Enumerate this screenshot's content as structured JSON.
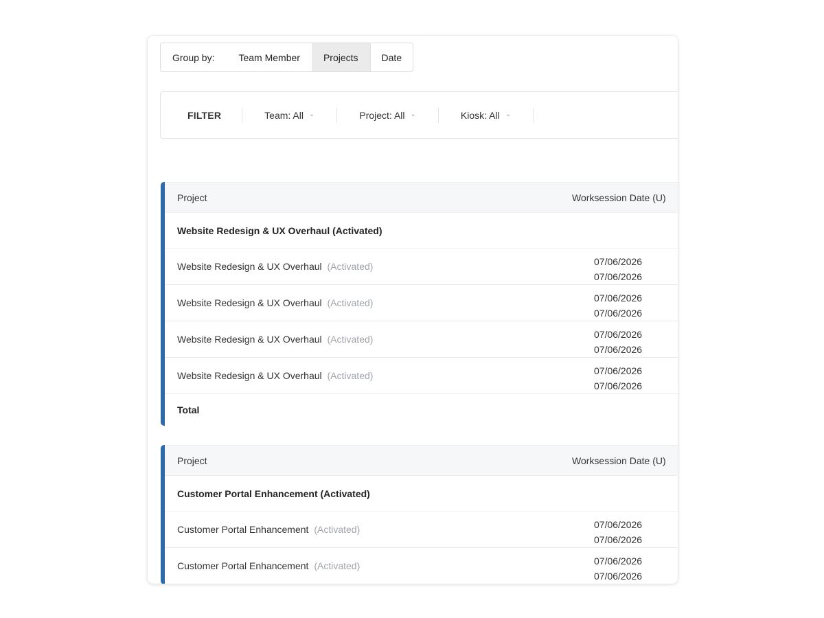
{
  "group_by": {
    "label": "Group by:",
    "options": [
      {
        "label": "Team Member",
        "active": false
      },
      {
        "label": "Projects",
        "active": true
      },
      {
        "label": "Date",
        "active": false
      }
    ]
  },
  "filter": {
    "title": "FILTER",
    "team": "Team: All",
    "project": "Project: All",
    "kiosk": "Kiosk: All"
  },
  "columns": {
    "project": "Project",
    "date": "Worksession Date (U)"
  },
  "sections": [
    {
      "group_title": "Website Redesign & UX Overhaul (Activated)",
      "rows": [
        {
          "name": "Website Redesign & UX Overhaul",
          "status": "(Activated)",
          "date1": "07/06/2026",
          "date2": "07/06/2026"
        },
        {
          "name": "Website Redesign & UX Overhaul",
          "status": "(Activated)",
          "date1": "07/06/2026",
          "date2": "07/06/2026"
        },
        {
          "name": "Website Redesign & UX Overhaul",
          "status": "(Activated)",
          "date1": "07/06/2026",
          "date2": "07/06/2026"
        },
        {
          "name": "Website Redesign & UX Overhaul",
          "status": "(Activated)",
          "date1": "07/06/2026",
          "date2": "07/06/2026"
        }
      ],
      "total_label": "Total"
    },
    {
      "group_title": "Customer Portal Enhancement (Activated)",
      "rows": [
        {
          "name": "Customer Portal Enhancement",
          "status": "(Activated)",
          "date1": "07/06/2026",
          "date2": "07/06/2026"
        },
        {
          "name": "Customer Portal Enhancement",
          "status": "(Activated)",
          "date1": "07/06/2026",
          "date2": "07/06/2026"
        }
      ]
    }
  ],
  "colors": {
    "accent": "#2f6aa8",
    "active_tab": "#ebebeb",
    "muted_text": "#a0a4aa"
  }
}
